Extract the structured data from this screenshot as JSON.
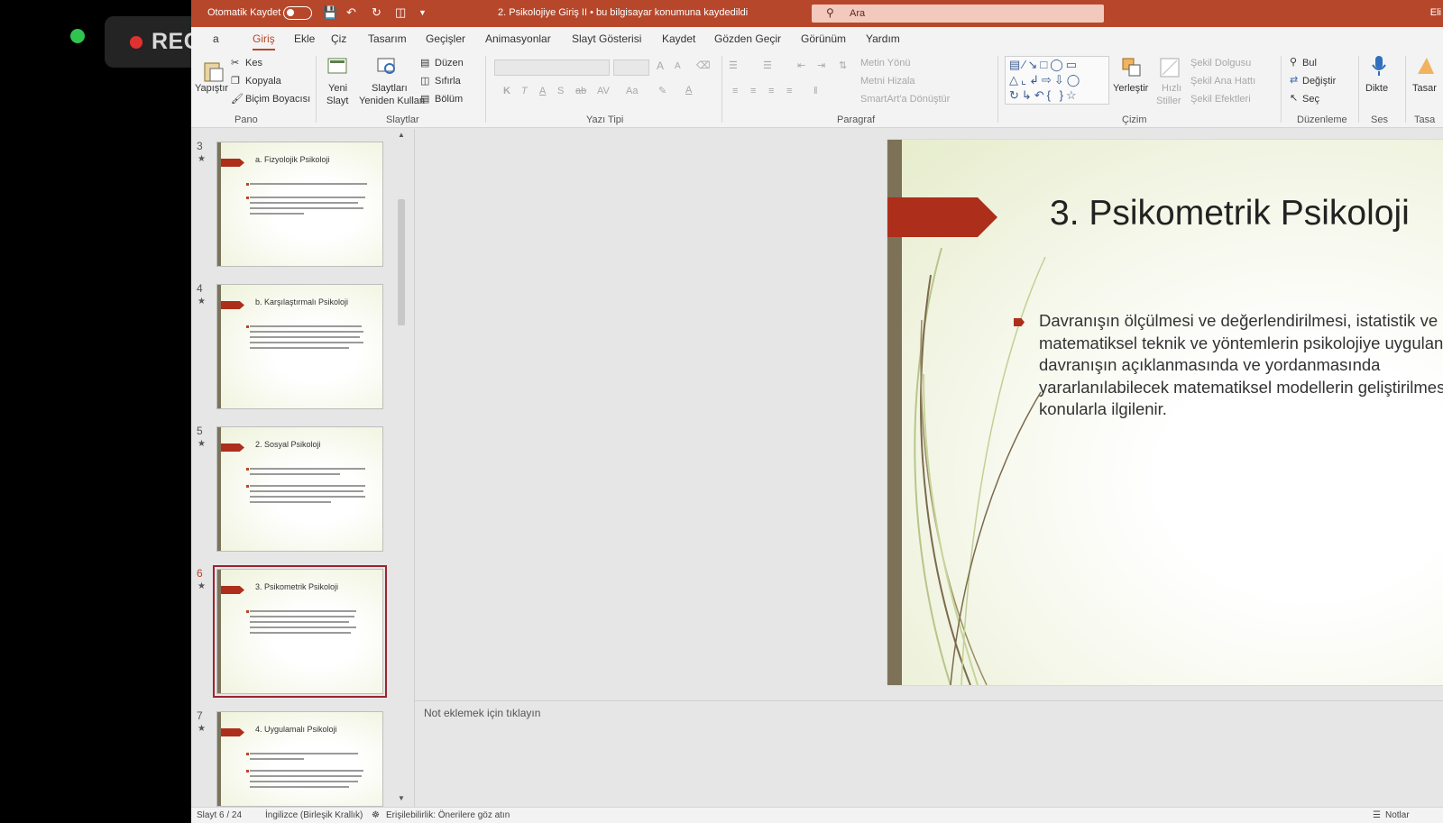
{
  "recording": {
    "label": "REC"
  },
  "titlebar": {
    "autosave_label": "Otomatik Kaydet",
    "document_title": "2. Psikolojiye Giriş II  •  bu bilgisayar konumuna kaydedildi",
    "search_placeholder": "Ara",
    "right_text": "Eli"
  },
  "tabs": [
    "a",
    "Giriş",
    "Ekle",
    "Çiz",
    "Tasarım",
    "Geçişler",
    "Animasyonlar",
    "Slayt Gösterisi",
    "Kaydet",
    "Gözden Geçir",
    "Görünüm",
    "Yardım"
  ],
  "active_tab": "Giriş",
  "ribbon": {
    "pano": {
      "label": "Pano",
      "paste": "Yapıştır",
      "cut": "Kes",
      "copy": "Kopyala",
      "format_painter": "Biçim Boyacısı"
    },
    "slaytlar": {
      "label": "Slaytlar",
      "new_slide_1": "Yeni",
      "new_slide_2": "Slayt",
      "reuse_1": "Slaytları",
      "reuse_2": "Yeniden Kullan",
      "layout": "Düzen",
      "reset": "Sıfırla",
      "section": "Bölüm"
    },
    "yazi_tipi": {
      "label": "Yazı Tipi",
      "bold": "K",
      "italic": "T",
      "underline": "A",
      "strike": "S",
      "abc": "ab",
      "spacing": "AV",
      "case": "Aa",
      "grow": "A",
      "shrink": "A"
    },
    "paragraf": {
      "label": "Paragraf",
      "text_direction": "Metin Yönü",
      "align_text": "Metni Hizala",
      "smartart": "SmartArt'a Dönüştür"
    },
    "cizim": {
      "label": "Çizim",
      "arrange": "Yerleştir",
      "quick_styles_1": "Hızlı",
      "quick_styles_2": "Stiller",
      "shape_fill": "Şekil Dolgusu",
      "shape_outline": "Şekil Ana Hattı",
      "shape_effects": "Şekil Efektleri"
    },
    "duzenleme": {
      "label": "Düzenleme",
      "find": "Bul",
      "replace": "Değiştir",
      "select": "Seç"
    },
    "ses": {
      "label": "Ses",
      "dictate": "Dikte"
    },
    "tasarim": {
      "label": "Tasa",
      "btn": "Tasar"
    }
  },
  "thumbnails": [
    {
      "num": "3",
      "title": "a. Fizyolojik Psikoloji",
      "selected": false
    },
    {
      "num": "4",
      "title": "b. Karşılaştırmalı Psikoloji",
      "selected": false
    },
    {
      "num": "5",
      "title": "2. Sosyal Psikoloji",
      "selected": false
    },
    {
      "num": "6",
      "title": "3. Psikometrik Psikoloji",
      "selected": true
    },
    {
      "num": "7",
      "title": "4. Uygulamalı Psikoloji",
      "selected": false
    }
  ],
  "slide": {
    "title": "3. Psikometrik Psikoloji",
    "body": "Davranışın ölçülmesi ve değerlendirilmesi, istatistik ve matematiksel teknik ve yöntemlerin psikolojiye uygulanması, davranışın açıklanmasında ve yordanmasında yararlanılabilecek matematiksel modellerin geliştirilmesi gibi konularla ilgilenir.",
    "accent_color": "#ad2e1a"
  },
  "notes": {
    "placeholder": "Not eklemek için tıklayın"
  },
  "statusbar": {
    "slide_info": "Slayt 6 / 24",
    "language": "İngilizce (Birleşik Krallık)",
    "accessibility": "Erişilebilirlik: Önerilere göz atın",
    "notes": "Notlar"
  }
}
